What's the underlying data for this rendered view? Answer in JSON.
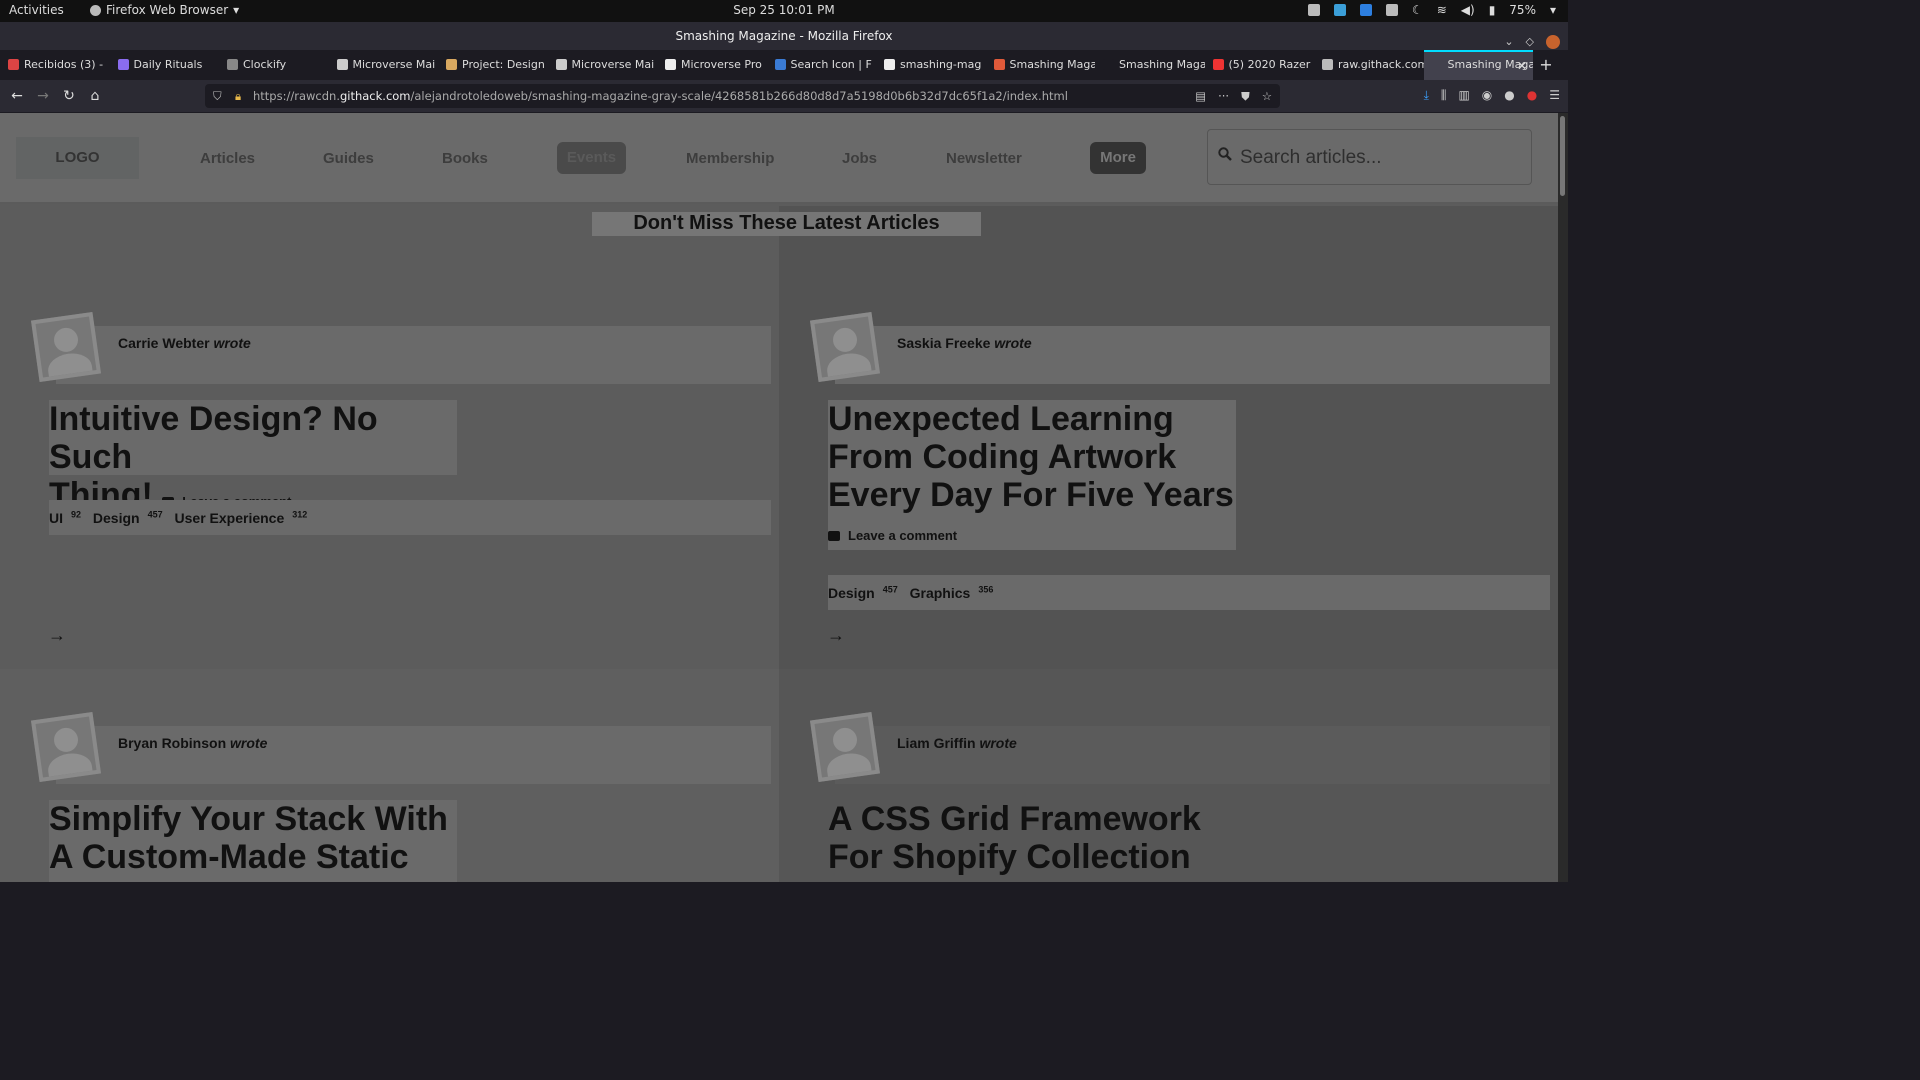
{
  "system": {
    "activities": "Activities",
    "app_menu": "Firefox Web Browser",
    "clock": "Sep 25  10:01 PM",
    "battery": "75%"
  },
  "window": {
    "title": "Smashing Magazine - Mozilla Firefox"
  },
  "tabs": [
    {
      "label": "Recibidos (3) -",
      "color": "#d44"
    },
    {
      "label": "Daily Rituals",
      "color": "#8a6cf0"
    },
    {
      "label": "Clockify",
      "color": "#888"
    },
    {
      "label": "Microverse Mai",
      "color": "#ccc"
    },
    {
      "label": "Project: Design",
      "color": "#d8a860"
    },
    {
      "label": "Microverse Mai",
      "color": "#ccc"
    },
    {
      "label": "Microverse Pro",
      "color": "#eee"
    },
    {
      "label": "Search Icon | F",
      "color": "#3a7bd5"
    },
    {
      "label": "smashing-mag",
      "color": "#eee"
    },
    {
      "label": "Smashing Maga",
      "color": "#e05a3a"
    },
    {
      "label": "Smashing Magazin",
      "color": "#1c1b22"
    },
    {
      "label": "(5) 2020 Razer",
      "color": "#e33"
    },
    {
      "label": "raw.githack.com",
      "color": "#bbb"
    },
    {
      "label": "Smashing Maga",
      "color": "#42414d",
      "active": true
    }
  ],
  "url": {
    "prefix": "https://rawcdn.",
    "host": "githack.com",
    "path": "/alejandrotoledoweb/smashing-magazine-gray-scale/4268581b266d80d8d7a5198d0b6b32d7dc65f1a2/index.html"
  },
  "site": {
    "logo": "LOGO",
    "nav": [
      "Articles",
      "Guides",
      "Books",
      "Events",
      "Membership",
      "Jobs",
      "Newsletter",
      "More"
    ],
    "search_placeholder": "Search articles...",
    "section_title": "Don't Miss These Latest Articles"
  },
  "articles": [
    {
      "author": "Carrie Webter",
      "wrote": "wrote",
      "title_lines": [
        "Intuitive Design? No Such",
        "Thing!"
      ],
      "comment": "Leave a comment",
      "tags": [
        {
          "name": "UI",
          "count": "92"
        },
        {
          "name": "Design",
          "count": "457"
        },
        {
          "name": "User Experience",
          "count": "312"
        }
      ]
    },
    {
      "author": "Saskia Freeke",
      "wrote": "wrote",
      "title_lines": [
        "Unexpected Learning",
        "From Coding Artwork",
        "Every Day For Five Years"
      ],
      "comment": "Leave a comment",
      "tags": [
        {
          "name": "Design",
          "count": "457"
        },
        {
          "name": "Graphics",
          "count": "356"
        }
      ]
    },
    {
      "author": "Bryan Robinson",
      "wrote": "wrote",
      "title_lines": [
        "Simplify Your Stack With",
        "A Custom-Made Static"
      ]
    },
    {
      "author": "Liam Griffin",
      "wrote": "wrote",
      "title_lines": [
        "A CSS Grid Framework",
        "For Shopify Collection"
      ]
    }
  ],
  "icons": {
    "arrow": "→",
    "back": "arrow-left-icon",
    "forward": "arrow-right-icon",
    "reload": "reload-icon",
    "home": "home-icon"
  }
}
